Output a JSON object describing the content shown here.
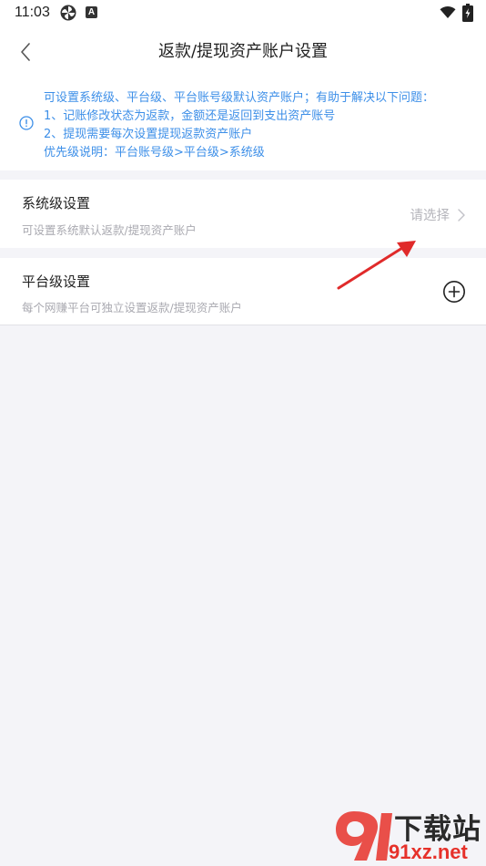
{
  "status_bar": {
    "time": "11:03",
    "icons": [
      "pinwheel-icon",
      "a-badge-icon",
      "wifi-icon",
      "battery-charging-icon"
    ],
    "badge_letter": "A"
  },
  "header": {
    "title": "返款/提现资产账户设置",
    "back_icon": "chevron-left-icon"
  },
  "info": {
    "icon": "info-circle-icon",
    "accent_color": "#3d8fe8",
    "lines": [
      "可设置系统级、平台级、平台账号级默认资产账户；有助于解决以下问题：",
      "1、记账修改状态为返款，金额还是返回到支出资产账号",
      "2、提现需要每次设置提现返款资产账户",
      "优先级说明：平台账号级>平台级>系统级"
    ]
  },
  "system_setting": {
    "title": "系统级设置",
    "subtitle": "可设置系统默认返款/提现资产账户",
    "action_label": "请选择",
    "action_icon": "chevron-right-icon"
  },
  "platform_setting": {
    "title": "平台级设置",
    "subtitle": "每个网赚平台可独立设置返款/提现资产账户",
    "action_icon": "plus-circle-icon"
  },
  "annotation": {
    "arrow_color": "#e02a2a"
  },
  "watermark": {
    "top_text": "下载站",
    "bottom_text": "91xz.net"
  }
}
